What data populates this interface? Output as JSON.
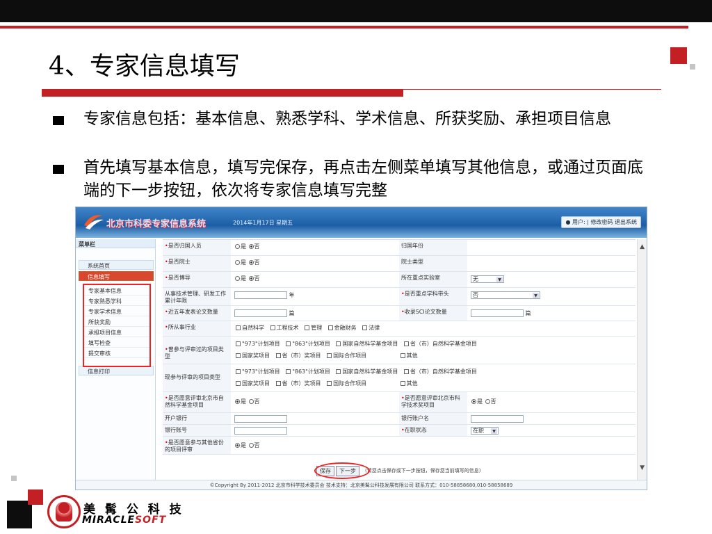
{
  "slide": {
    "title": "4、专家信息填写",
    "bullets": [
      "专家信息包括：基本信息、熟悉学科、学术信息、所获奖励、承担项目信息",
      "首先填写基本信息，填写完保存，再点击左侧菜单填写其他信息，或通过页面底端的下一步按钮，依次将专家信息填写完整"
    ],
    "brand": {
      "cn": "美 髯 公 科 技",
      "en_a": "MIRACLE",
      "en_b": "SOFT",
      "colors": {
        "accent": "#c32026"
      }
    }
  },
  "app": {
    "name": "北京市科委专家信息系统",
    "date": "2014年1月17日 星期五",
    "user": "用户:",
    "user_links": "| 修改密码 退出系统",
    "menu_title": "菜单栏",
    "menu": [
      {
        "label": "系统首页",
        "active": false
      },
      {
        "label": "信息填写",
        "active": true
      }
    ],
    "submenu": [
      "专家基本信息",
      "专家熟悉学科",
      "专家学术信息",
      "所获奖励",
      "承担项目信息",
      "填写检查",
      "提交审核"
    ],
    "menu_print": "信息打印",
    "form": {
      "r1": {
        "l1": "是否归国人员",
        "yes": "是",
        "no": "否",
        "l2": "归国年份"
      },
      "r2": {
        "l1": "是否院士",
        "yes": "是",
        "no": "否",
        "l2": "院士类型"
      },
      "r3": {
        "l1": "是否博导",
        "yes": "是",
        "no": "否",
        "l2": "所在重点实验室",
        "sel": "无"
      },
      "r4": {
        "l1": "从事技术管理、研发工作累计年限",
        "unit": "年",
        "l2": "是否重点学科带头",
        "sel": "否"
      },
      "r5": {
        "l1": "近五年发表论文数量",
        "unit": "篇",
        "l2": "收录SCI论文数量",
        "unit2": "篇"
      },
      "r6": {
        "l1": "所从事行业",
        "opts": [
          "自然科学",
          "工程技术",
          "管理",
          "金融财务",
          "法律"
        ]
      },
      "r7": {
        "l1": "曾参与评审过的项目类型",
        "line1": [
          "\"973\"计划项目",
          "\"863\"计划项目",
          "国家自然科学基金项目",
          "省（市）自然科学基金项目"
        ],
        "line2": [
          "国家奖项目",
          "省（市）奖项目",
          "国际合作项目",
          "其他"
        ]
      },
      "r8": {
        "l1": "现参与评审的项目类型",
        "line1": [
          "\"973\"计划项目",
          "\"863\"计划项目",
          "国家自然科学基金项目",
          "省（市）自然科学基金项目"
        ],
        "line2": [
          "国家奖项目",
          "省（市）奖项目",
          "国际合作项目",
          "其他"
        ]
      },
      "r9": {
        "l1": "是否愿意评审北京市自然科学基金项目",
        "yes": "是",
        "no": "否",
        "l2": "是否愿意评审北京市科学技术奖项目"
      },
      "r10": {
        "l1": "开户银行",
        "l2": "银行账户名"
      },
      "r11": {
        "l1": "银行账号",
        "l2": "在职状态",
        "sel": "在职"
      },
      "r12": {
        "l1": "是否愿意参与其他省份的项目评审",
        "yes": "是",
        "no": "否"
      }
    },
    "save_btn": "保存",
    "next_btn": "下一步",
    "hint": "(请您点击保存或下一步按钮，保存您当前填写的信息)",
    "footer": "©Copyright By 2011-2012 北京市科学技术委员会   技术支持：北京美髯公科技发展有限公司   联系方式：010-58858680,010-58858689"
  }
}
